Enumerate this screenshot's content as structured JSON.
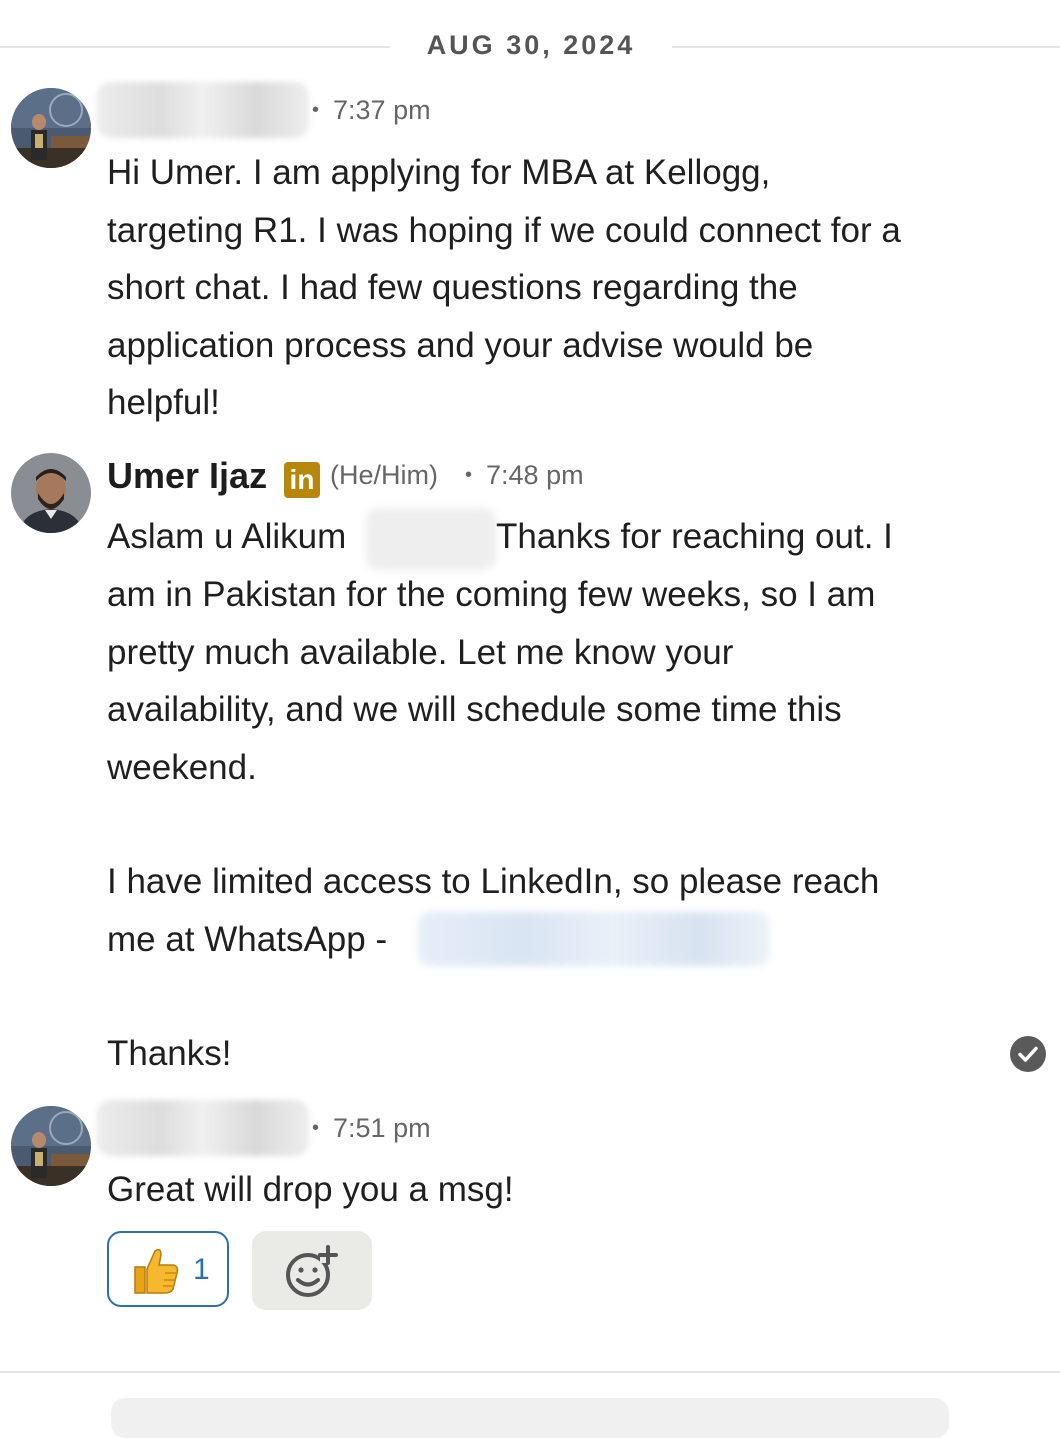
{
  "date_divider": "AUG 30, 2024",
  "messages": [
    {
      "sender": "",
      "time": "7:37 pm",
      "text": "Hi Umer. I am applying for MBA at Kellogg,\ntargeting R1. I was hoping if we could connect for a\nshort chat. I had few questions regarding the\napplication process and your advise would be\nhelpful!"
    },
    {
      "sender": "Umer Ijaz",
      "badge": "in",
      "pronouns": "(He/Him)",
      "time": "7:48 pm",
      "text_greeting": "Aslam u Alikum",
      "text_after_greeting": "Thanks for reaching out. I",
      "text_body": "am in Pakistan for the coming few weeks, so I am\npretty much available. Let me know your\navailability, and we will schedule some time this\nweekend.",
      "text_whatsapp": "I have limited access to LinkedIn, so please reach\nme at WhatsApp -",
      "text_signoff": "Thanks!"
    },
    {
      "sender": "",
      "time": "7:51 pm",
      "text": "Great will drop you a msg!"
    }
  ],
  "reaction": {
    "emoji": "thumbs-up-icon",
    "count": "1"
  },
  "icons": {
    "read_receipt": "check-circle-icon",
    "add_reaction": "add-emoji-icon"
  },
  "colors": {
    "reaction_border": "#2d6fb3",
    "linkedin_badge": "#b8860b",
    "divider": "#e3e3e3"
  }
}
